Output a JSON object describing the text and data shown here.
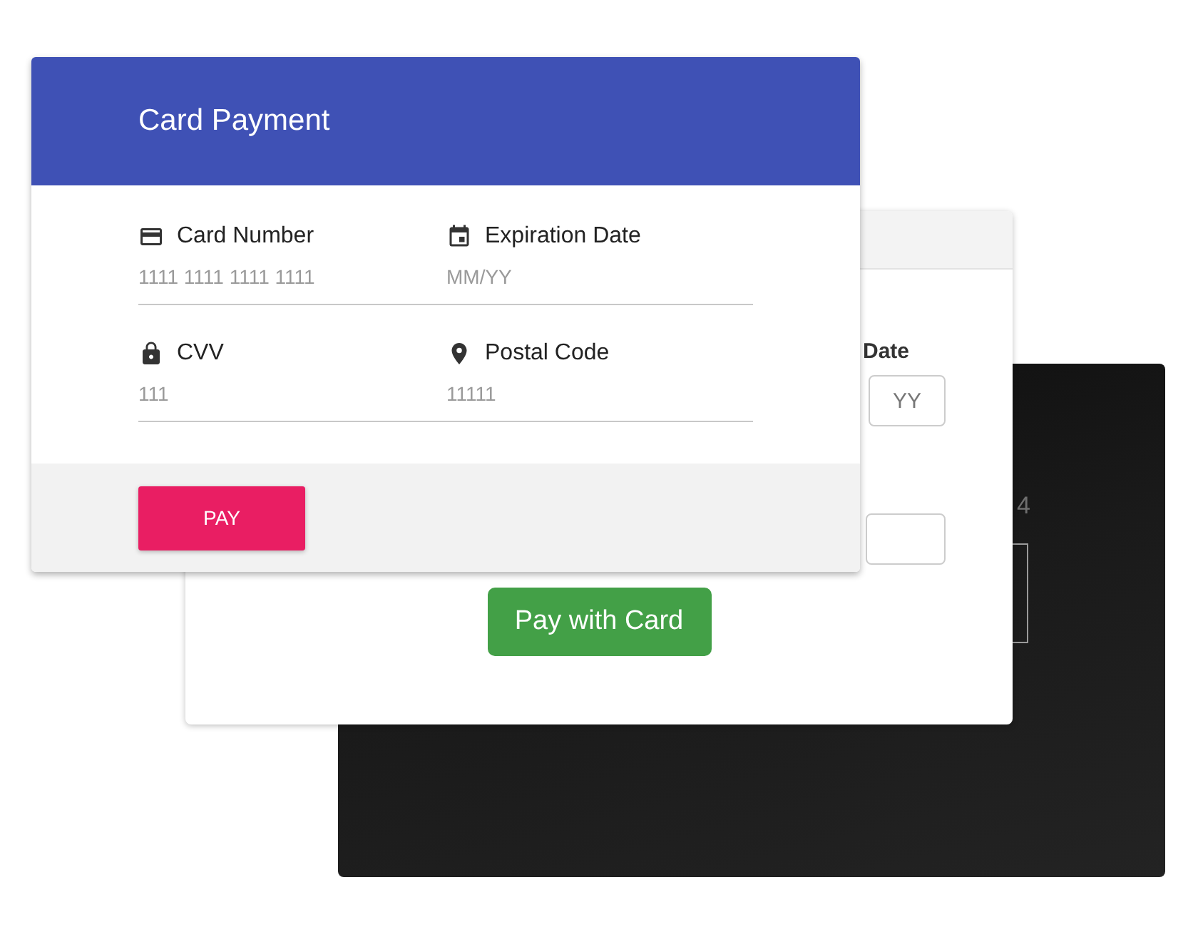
{
  "front_card": {
    "title": "Card Payment",
    "fields": [
      {
        "label": "Card Number",
        "placeholder": "1111 1111 1111 1111"
      },
      {
        "label": "Expiration Date",
        "placeholder": "MM/YY"
      },
      {
        "label": "CVV",
        "placeholder": "111"
      },
      {
        "label": "Postal Code",
        "placeholder": "11111"
      }
    ],
    "pay_button": "PAY"
  },
  "middle_card": {
    "date_label": "Date",
    "year_field": {
      "placeholder": "YY"
    },
    "pay_button": "Pay with Card"
  },
  "back_card": {
    "digit": "4"
  }
}
